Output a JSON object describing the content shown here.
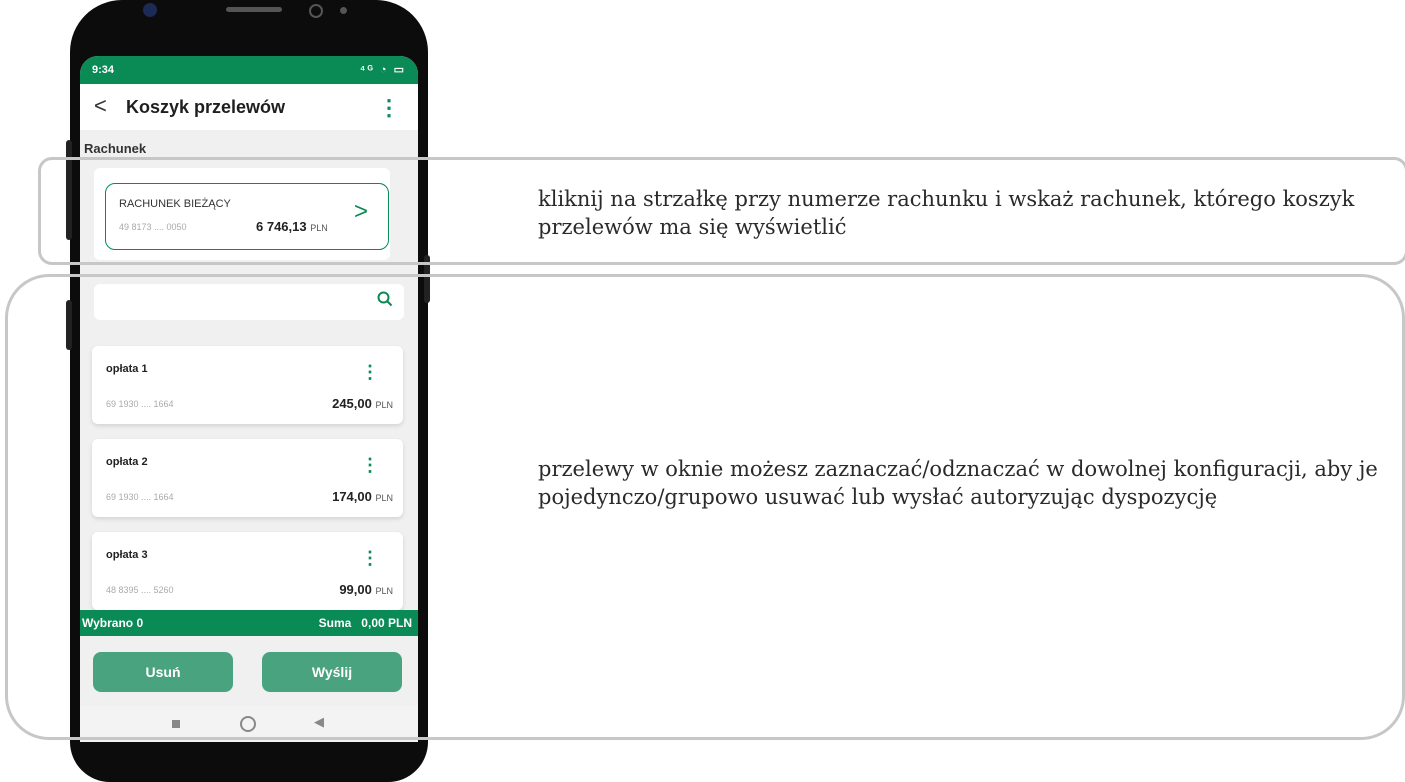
{
  "status": {
    "time": "9:34",
    "icons": "⁴ᴳ ◔ ▭"
  },
  "appbar": {
    "back": "<",
    "title": "Koszyk przelewów",
    "menu": "⋮"
  },
  "account_section": {
    "label": "Rachunek",
    "name": "RACHUNEK BIEŻĄCY",
    "number": "49 8173 .... 0050",
    "amount": "6 746,13",
    "currency": "PLN",
    "chevron": ">"
  },
  "search": {
    "placeholder": "",
    "icon": "search-icon"
  },
  "transfers": [
    {
      "name": "opłata 1",
      "number": "69 1930 .... 1664",
      "amount": "245,00",
      "currency": "PLN"
    },
    {
      "name": "opłata 2",
      "number": "69 1930 .... 1664",
      "amount": "174,00",
      "currency": "PLN"
    },
    {
      "name": "opłata 3",
      "number": "48 8395 .... 5260",
      "amount": "99,00",
      "currency": "PLN"
    }
  ],
  "footer": {
    "selected": "Wybrano 0",
    "sum": "Suma   0,00 PLN"
  },
  "buttons": {
    "delete": "Usuń",
    "send": "Wyślij"
  },
  "annotations": {
    "account_note": "kliknij na strzałkę przy numerze rachunku i wskaż rachunek, którego koszyk przelewów ma się wyświetlić",
    "list_note": "przelewy w oknie możesz zaznaczać/odznaczać w dowolnej konfiguracji, aby je pojedynczo/grupowo usuwać lub wysłać autoryzując dyspozycję"
  },
  "colors": {
    "brand": "#0a8a55",
    "button": "#4aa37f",
    "frame": "#c7c7c7"
  }
}
